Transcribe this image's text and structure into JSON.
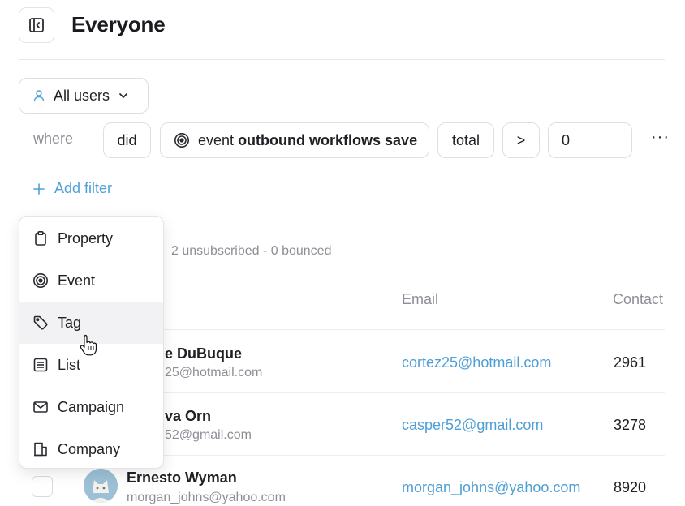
{
  "header": {
    "title": "Everyone"
  },
  "segment": {
    "label": "All users"
  },
  "filter": {
    "where_label": "where",
    "verb": "did",
    "event_prefix": "event",
    "event_name": "outbound workflows save",
    "aggregate": "total",
    "operator": ">",
    "value": "0",
    "more_label": "···",
    "add_filter_label": "Add filter"
  },
  "summary": "2 unsubscribed - 0 bounced",
  "table": {
    "columns": {
      "email": "Email",
      "contact": "Contact"
    },
    "rows": [
      {
        "name": "e DuBuque",
        "sub": "25@hotmail.com",
        "email": "cortez25@hotmail.com",
        "contact": "2961"
      },
      {
        "name": "va Orn",
        "sub": "52@gmail.com",
        "email": "casper52@gmail.com",
        "contact": "3278"
      },
      {
        "name": "Ernesto Wyman",
        "sub": "morgan_johns@yahoo.com",
        "email": "morgan_johns@yahoo.com",
        "contact": "8920"
      }
    ]
  },
  "menu": {
    "items": [
      {
        "label": "Property",
        "icon": "clipboard-icon"
      },
      {
        "label": "Event",
        "icon": "target-icon"
      },
      {
        "label": "Tag",
        "icon": "tag-icon"
      },
      {
        "label": "List",
        "icon": "list-icon"
      },
      {
        "label": "Campaign",
        "icon": "mail-icon"
      },
      {
        "label": "Company",
        "icon": "building-icon"
      }
    ],
    "hovered": "Tag"
  },
  "colors": {
    "accent": "#4d9fd6",
    "muted": "#8e8e96",
    "border": "#dedee4"
  }
}
